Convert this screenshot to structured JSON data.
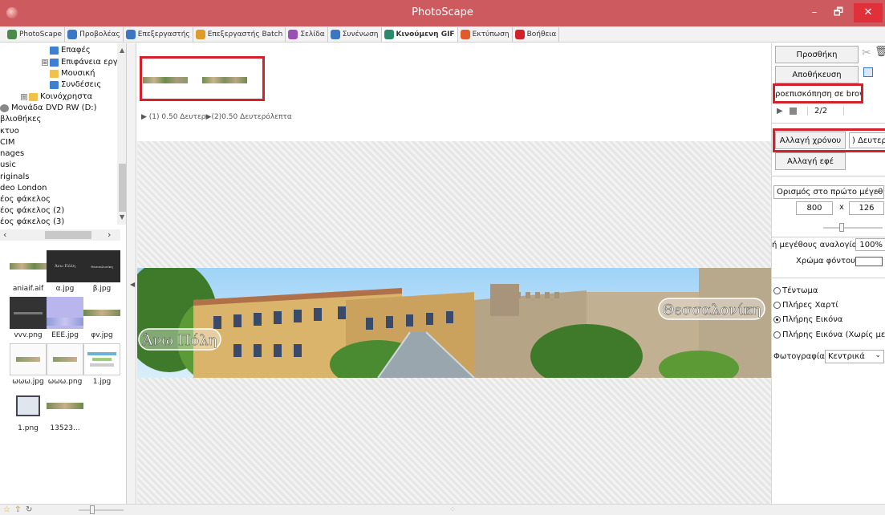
{
  "window": {
    "title": "PhotoScape",
    "minimize": "–",
    "restore": "🗗",
    "close": "✕"
  },
  "tabs": [
    {
      "label": "PhotoScape",
      "color": "#4a8a4a"
    },
    {
      "label": "Προβολέας",
      "color": "#3a78c4"
    },
    {
      "label": "Επεξεργαστής",
      "color": "#3a78c4"
    },
    {
      "label": "Επεξεργαστής Batch",
      "color": "#e09a2a"
    },
    {
      "label": "Σελίδα",
      "color": "#9c4fb4"
    },
    {
      "label": "Συνένωση",
      "color": "#3a78c4"
    },
    {
      "label": "Κινούμενη GIF",
      "color": "#2a8a6a"
    },
    {
      "label": "Εκτύπωση",
      "color": "#e05a2a"
    },
    {
      "label": "Βοήθεια",
      "color": "#d4202a"
    }
  ],
  "tree": [
    {
      "label": "Επαφές",
      "icon": "folder-blue"
    },
    {
      "label": "Επιφάνεια εργασία",
      "icon": "folder-blue"
    },
    {
      "label": "Μουσική",
      "icon": "folder"
    },
    {
      "label": "Συνδέσεις",
      "icon": "folder-blue"
    },
    {
      "label": "Κοινόχρηστα",
      "icon": "folder"
    },
    {
      "label": "Μονάδα DVD RW (D:)",
      "icon": "disc"
    },
    {
      "label": "βλιοθήκες",
      "icon": ""
    },
    {
      "label": "κτυο",
      "icon": ""
    },
    {
      "label": "CIM",
      "icon": ""
    },
    {
      "label": "nages",
      "icon": ""
    },
    {
      "label": "usic",
      "icon": ""
    },
    {
      "label": "riginals",
      "icon": ""
    },
    {
      "label": "deo London",
      "icon": ""
    },
    {
      "label": "έος φάκελος",
      "icon": ""
    },
    {
      "label": "έος φάκελος (2)",
      "icon": ""
    },
    {
      "label": "έος φάκελος (3)",
      "icon": ""
    }
  ],
  "tree_expanders": [
    "⊞",
    "⊞"
  ],
  "thumbnails": [
    {
      "caption": "aniaif.aif",
      "kind": "banner"
    },
    {
      "caption": "α.jpg",
      "kind": "dark",
      "overlay": "Άνω Πόλη"
    },
    {
      "caption": "β.jpg",
      "kind": "dark",
      "overlay": "Θεσσαλονίκη"
    },
    {
      "caption": "vvv.png",
      "kind": "dark2"
    },
    {
      "caption": "ΕΕΕ.jpg",
      "kind": "lavender"
    },
    {
      "caption": "φv.jpg",
      "kind": "banner"
    },
    {
      "caption": "ωωω.jpg",
      "kind": "screen"
    },
    {
      "caption": "ωωω.png",
      "kind": "screen"
    },
    {
      "caption": "1.jpg",
      "kind": "chart"
    },
    {
      "caption": "1.png",
      "kind": "window"
    },
    {
      "caption": "13523...",
      "kind": "banner"
    }
  ],
  "frames_info": "▶ (1) 0.50 Δευτερ▶(2)0.50 Δευτερόλεπτα",
  "banner": {
    "left_text": "Άνω Πόλη",
    "right_text": "Θεσσαλονίκη"
  },
  "right_panel": {
    "add_button": "Προσθήκη",
    "save_button": "Αποθήκευση",
    "browser_preview": "ροεπισκόπηση σε brows",
    "page_counter": "2/2",
    "change_time_button": "Αλλαγή χρόνου",
    "time_field": ") Δευτερόλ",
    "change_effect_button": "Αλλαγή εφέ",
    "size_select": "Ορισμός στο πρώτο μέγεθο",
    "width_value": "800",
    "times_sign": "x",
    "height_value": "126",
    "ratio_label": "ή μεγέθους αναλογίας",
    "ratio_value": "100%",
    "bg_color_label": "Χρώμα φόντου",
    "radios": [
      {
        "label": "Τέντωμα",
        "checked": false
      },
      {
        "label": "Πλήρες Χαρτί",
        "checked": false
      },
      {
        "label": "Πλήρης Εικόνα",
        "checked": true
      },
      {
        "label": "Πλήρης Εικόνα (Χωρίς μεγέθυ",
        "checked": false
      }
    ],
    "photo_label": "Φωτογραφίας",
    "photo_select": "Κεντρικά"
  }
}
